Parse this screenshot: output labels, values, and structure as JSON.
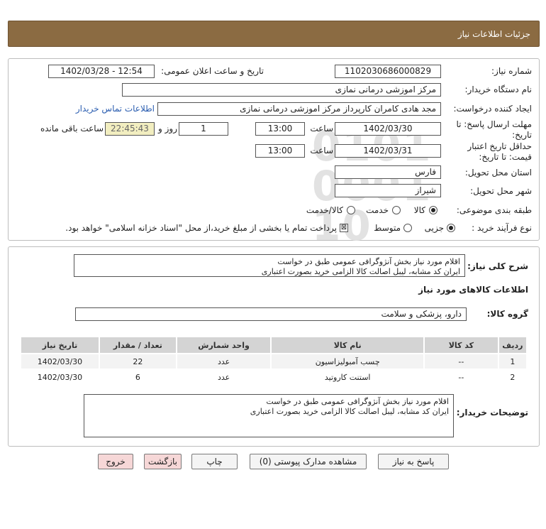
{
  "header": {
    "title": "جزئیات اطلاعات نیاز"
  },
  "form": {
    "need_number_label": "شماره نیاز:",
    "need_number": "1102030686000829",
    "announce_label": "تاریخ و ساعت اعلان عمومی:",
    "announce_value": "1402/03/28 - 12:54",
    "buyer_org_label": "نام دستگاه خریدار:",
    "buyer_org": "مرکز اموزشی درمانی نمازی",
    "requester_label": "ایجاد کننده درخواست:",
    "requester": "مجد هادی کامران کارپرداز مرکز اموزشی درمانی نمازی",
    "contact_link": "اطلاعات تماس خریدار",
    "deadline_label_1": "مهلت ارسال پاسخ: تا",
    "deadline_label_2": "تاریخ:",
    "deadline_date": "1402/03/30",
    "time_label": "ساعت",
    "deadline_time": "13:00",
    "days_value": "1",
    "days_label": "روز و",
    "remaining_time": "22:45:43",
    "remaining_label": "ساعت باقی مانده",
    "validity_label_1": "حداقل تاریخ اعتبار",
    "validity_label_2": "قیمت: تا تاریخ:",
    "validity_date": "1402/03/31",
    "validity_time": "13:00",
    "province_label": "استان محل تحویل:",
    "province": "فارس",
    "city_label": "شهر محل تحویل:",
    "city": "شیراز",
    "category_label": "طبقه بندی موضوعی:",
    "category_options": [
      "کالا",
      "خدمت",
      "کالا/خدمت"
    ],
    "category_selected": "کالا",
    "process_label": "نوع فرآیند خرید :",
    "process_options": [
      "جزیی",
      "متوسط"
    ],
    "process_selected": "جزیی",
    "payment_note": "پرداخت تمام یا بخشی از مبلغ خرید،از محل \"اسناد خزانه اسلامی\" خواهد بود."
  },
  "summary": {
    "label": "شرح کلی نیاز:",
    "lines": [
      "اقلام مورد نیاز بخش آنژوگرافی عمومی طبق در خواست",
      "ایران کد مشابه، لیبل اصالت کالا الزامی خرید بصورت اعتباری"
    ]
  },
  "goods": {
    "section_title": "اطلاعات کالاهای مورد نیاز",
    "group_label": "گروه کالا:",
    "group_value": "دارو، پزشکی و سلامت",
    "columns": [
      "ردیف",
      "کد کالا",
      "نام کالا",
      "واحد شمارش",
      "تعداد / مقدار",
      "تاریخ نیاز"
    ],
    "rows": [
      [
        "1",
        "--",
        "چسب آمبولیزاسیون",
        "عدد",
        "22",
        "1402/03/30"
      ],
      [
        "2",
        "--",
        "استنت کاروتید",
        "عدد",
        "6",
        "1402/03/30"
      ]
    ]
  },
  "buyer_notes": {
    "label": "توضیحات خریدار:",
    "lines": [
      "اقلام مورد نیاز بخش آنژوگرافی عمومی طبق در خواست",
      "ایران کد مشابه، لیبل اصالت کالا الزامی خرید بصورت اعتباری"
    ]
  },
  "buttons": {
    "reply": "پاسخ به نیاز",
    "attachments": "مشاهده مدارک پیوستی (0)",
    "print": "چاپ",
    "back": "بازگشت",
    "exit": "خروج"
  },
  "watermark": {
    "brand": "ParsNamadData",
    "line1": "پارس نماد داده ها",
    "line2": "پایگاه اطلاع رسانی مناقصات و مزایده",
    "phone": "۰۲۱-۸۸۳۴۹۶۷۰-۵"
  }
}
